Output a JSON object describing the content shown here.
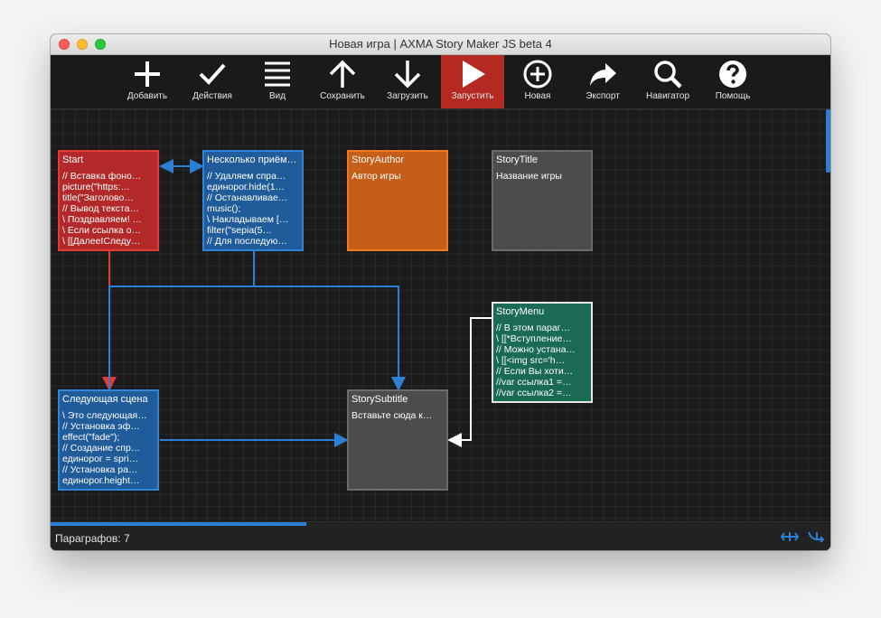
{
  "window": {
    "title": "Новая игра | AXMA Story Maker JS beta 4"
  },
  "toolbar": {
    "add": "Добавить",
    "actions": "Действия",
    "view": "Вид",
    "save": "Сохранить",
    "load": "Загрузить",
    "run": "Запустить",
    "new": "Новая",
    "export": "Экспорт",
    "navigator": "Навигатор",
    "help": "Помощь",
    "active_color": "#b42a22"
  },
  "nodes": {
    "start": {
      "title": "Start",
      "lines": [
        "// Вставка фоно…",
        "picture(\"https:…",
        "title(\"Заголово…",
        "// Вывод текста…",
        "\\ Поздравляем! …",
        "\\ Если ссылка о…",
        "\\ [[ДалееIСледу…"
      ]
    },
    "tricks": {
      "title": "Несколько приём…",
      "lines": [
        "// Удаляем спра…",
        "единорог.hide(1…",
        "// Останавливае…",
        "music();",
        "\\ Накладываем […",
        "filter(\"sepia(5…",
        "// Для последую…"
      ]
    },
    "author": {
      "title": "StoryAuthor",
      "lines": [
        "Автор игры"
      ]
    },
    "storytitle": {
      "title": "StoryTitle",
      "lines": [
        "Название игры"
      ]
    },
    "menu": {
      "title": "StoryMenu",
      "lines": [
        "// В этом параг…",
        "\\ [[*Вступление…",
        "// Можно устана…",
        "\\ [[<img src='h…",
        "// Если Вы хоти…",
        "//var ссылка1 =…",
        "//var ссылка2 =…"
      ]
    },
    "next": {
      "title": "Следующая сцена",
      "lines": [
        "\\ Это следующая…",
        "// Установка эф…",
        "effect(\"fade\");",
        "// Создание спр…",
        "единорог = spri…",
        "// Установка ра…",
        "единорог.height…"
      ]
    },
    "subtitle": {
      "title": "StorySubtitle",
      "lines": [
        "Вставьте сюда к…"
      ]
    }
  },
  "colors": {
    "link_blue": "#2d7fd3",
    "link_red": "#e03a32",
    "link_white": "#ffffff"
  },
  "status": {
    "paragraphs": "Параграфов: 7"
  },
  "icons": {
    "fit": "arrows-horizontal-icon",
    "route": "route-icon"
  }
}
